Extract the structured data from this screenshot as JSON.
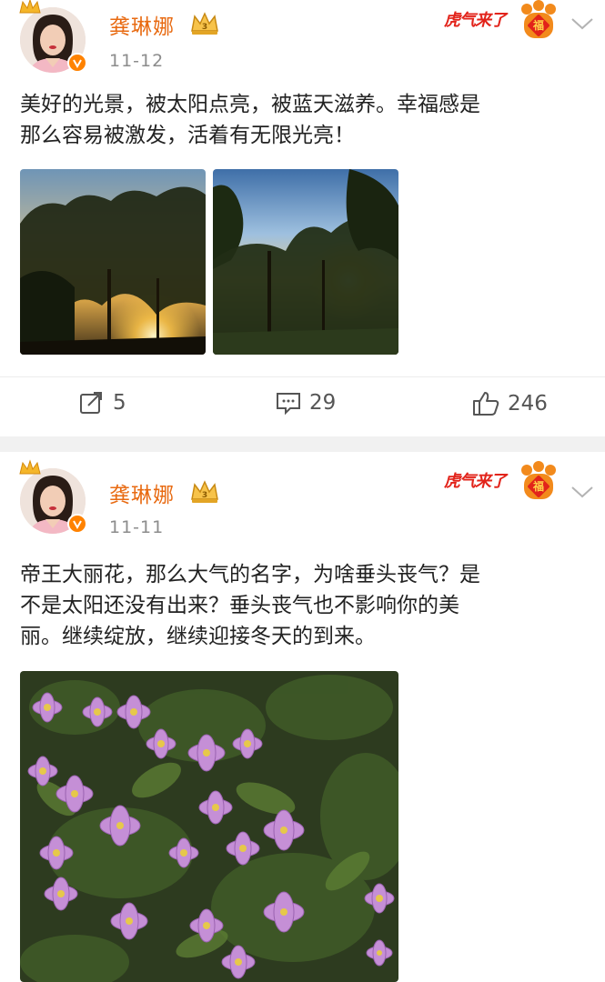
{
  "posts": [
    {
      "username": "龚琳娜",
      "date": "11-12",
      "badge_text": "虎气来了",
      "text": "美好的光景，被太阳点亮，被蓝天滋养。幸福感是\n那么容易被激发，活着有无限光亮！",
      "images": [
        "sunset-through-trees-1",
        "sunset-through-trees-2"
      ],
      "actions": {
        "repost_count": "5",
        "comment_count": "29",
        "like_count": "246"
      }
    },
    {
      "username": "龚琳娜",
      "date": "11-11",
      "badge_text": "虎气来了",
      "text": "帝王大丽花，那么大气的名字，为啥垂头丧气？是\n不是太阳还没有出来？垂头丧气也不影响你的美\n丽。继续绽放，继续迎接冬天的到来。",
      "images": [
        "purple-dahlia-flowers"
      ]
    }
  ],
  "icons": {
    "repost": "repost-icon",
    "comment": "comment-icon",
    "like": "like-icon",
    "more": "chevron-down-icon",
    "verified": "verified-badge-icon",
    "vip": "vip-crown-icon"
  },
  "colors": {
    "username": "#e86a11",
    "verified": "#ff8200",
    "badge_red": "#e2231a",
    "text": "#222222",
    "meta": "#8c8c8c",
    "divider": "#f1f1f1"
  }
}
